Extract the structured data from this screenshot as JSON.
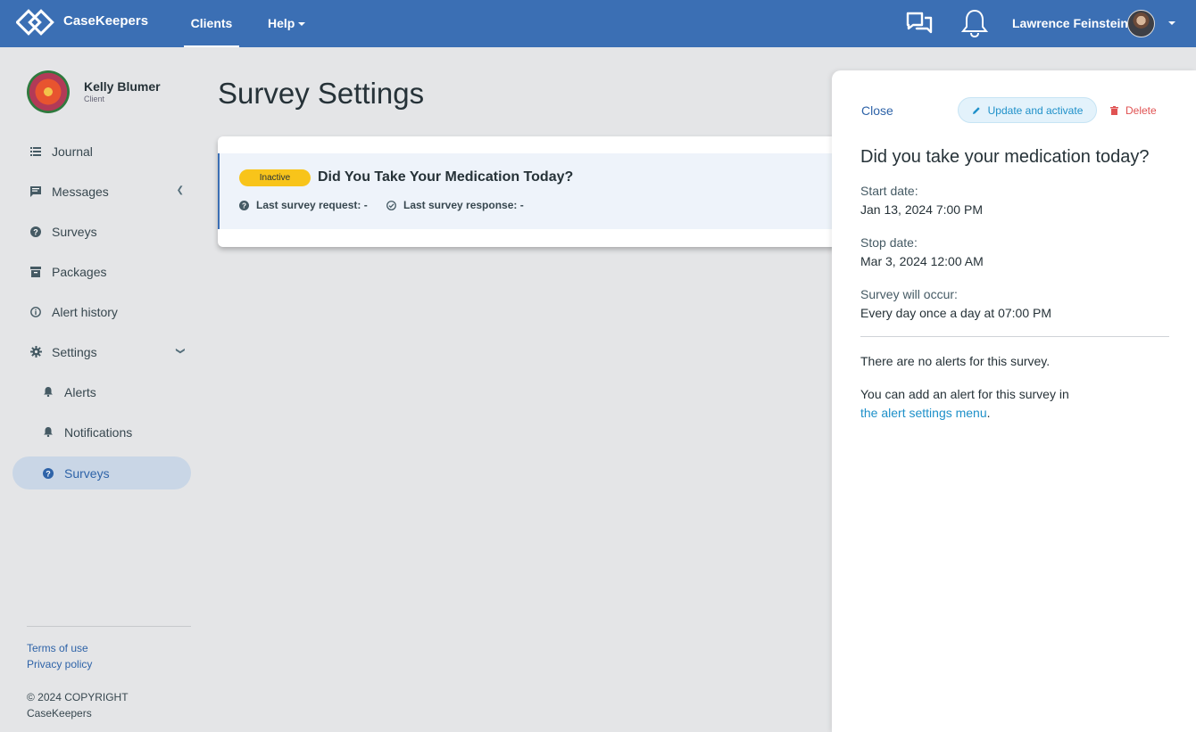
{
  "topbar": {
    "brand": "CaseKeepers",
    "nav": {
      "clients": "Clients",
      "help": "Help"
    },
    "user_name": "Lawrence Feinstein",
    "colors": {
      "bar": "#3b6fb4"
    }
  },
  "sidebar": {
    "client_name": "Kelly Blumer",
    "client_role": "Client",
    "items": [
      {
        "label": "Journal",
        "icon": "list-icon"
      },
      {
        "label": "Messages",
        "icon": "message-icon"
      },
      {
        "label": "Surveys",
        "icon": "question-circle-icon"
      },
      {
        "label": "Packages",
        "icon": "archive-icon"
      },
      {
        "label": "Alert history",
        "icon": "info-circle-icon"
      },
      {
        "label": "Settings",
        "icon": "gear-icon"
      },
      {
        "label": "Alerts",
        "icon": "bell-icon"
      },
      {
        "label": "Notifications",
        "icon": "bell-icon"
      },
      {
        "label": "Surveys",
        "icon": "question-circle-icon"
      }
    ],
    "footer": {
      "terms": "Terms of use",
      "privacy": "Privacy policy",
      "copyright_line1": "© 2024 COPYRIGHT",
      "copyright_line2": "CaseKeepers"
    }
  },
  "main": {
    "title": "Survey Settings",
    "survey_card": {
      "status": "Inactive",
      "title": "Did You Take Your Medication Today?",
      "last_request": "Last survey request: -",
      "last_response": "Last survey response: -"
    }
  },
  "drawer": {
    "close": "Close",
    "update_button": "Update and activate",
    "delete_button": "Delete",
    "title": "Did you take your medication today?",
    "start_label": "Start date:",
    "start_value": "Jan 13, 2024 7:00 PM",
    "stop_label": "Stop date:",
    "stop_value": "Mar 3, 2024 12:00 AM",
    "occur_label": "Survey will occur:",
    "occur_value": "Every day once a day at 07:00 PM",
    "no_alerts": "There are no alerts for this survey.",
    "add_alert_text": "You can add an alert for this survey in",
    "add_alert_link": "the alert settings menu",
    "period": "."
  }
}
